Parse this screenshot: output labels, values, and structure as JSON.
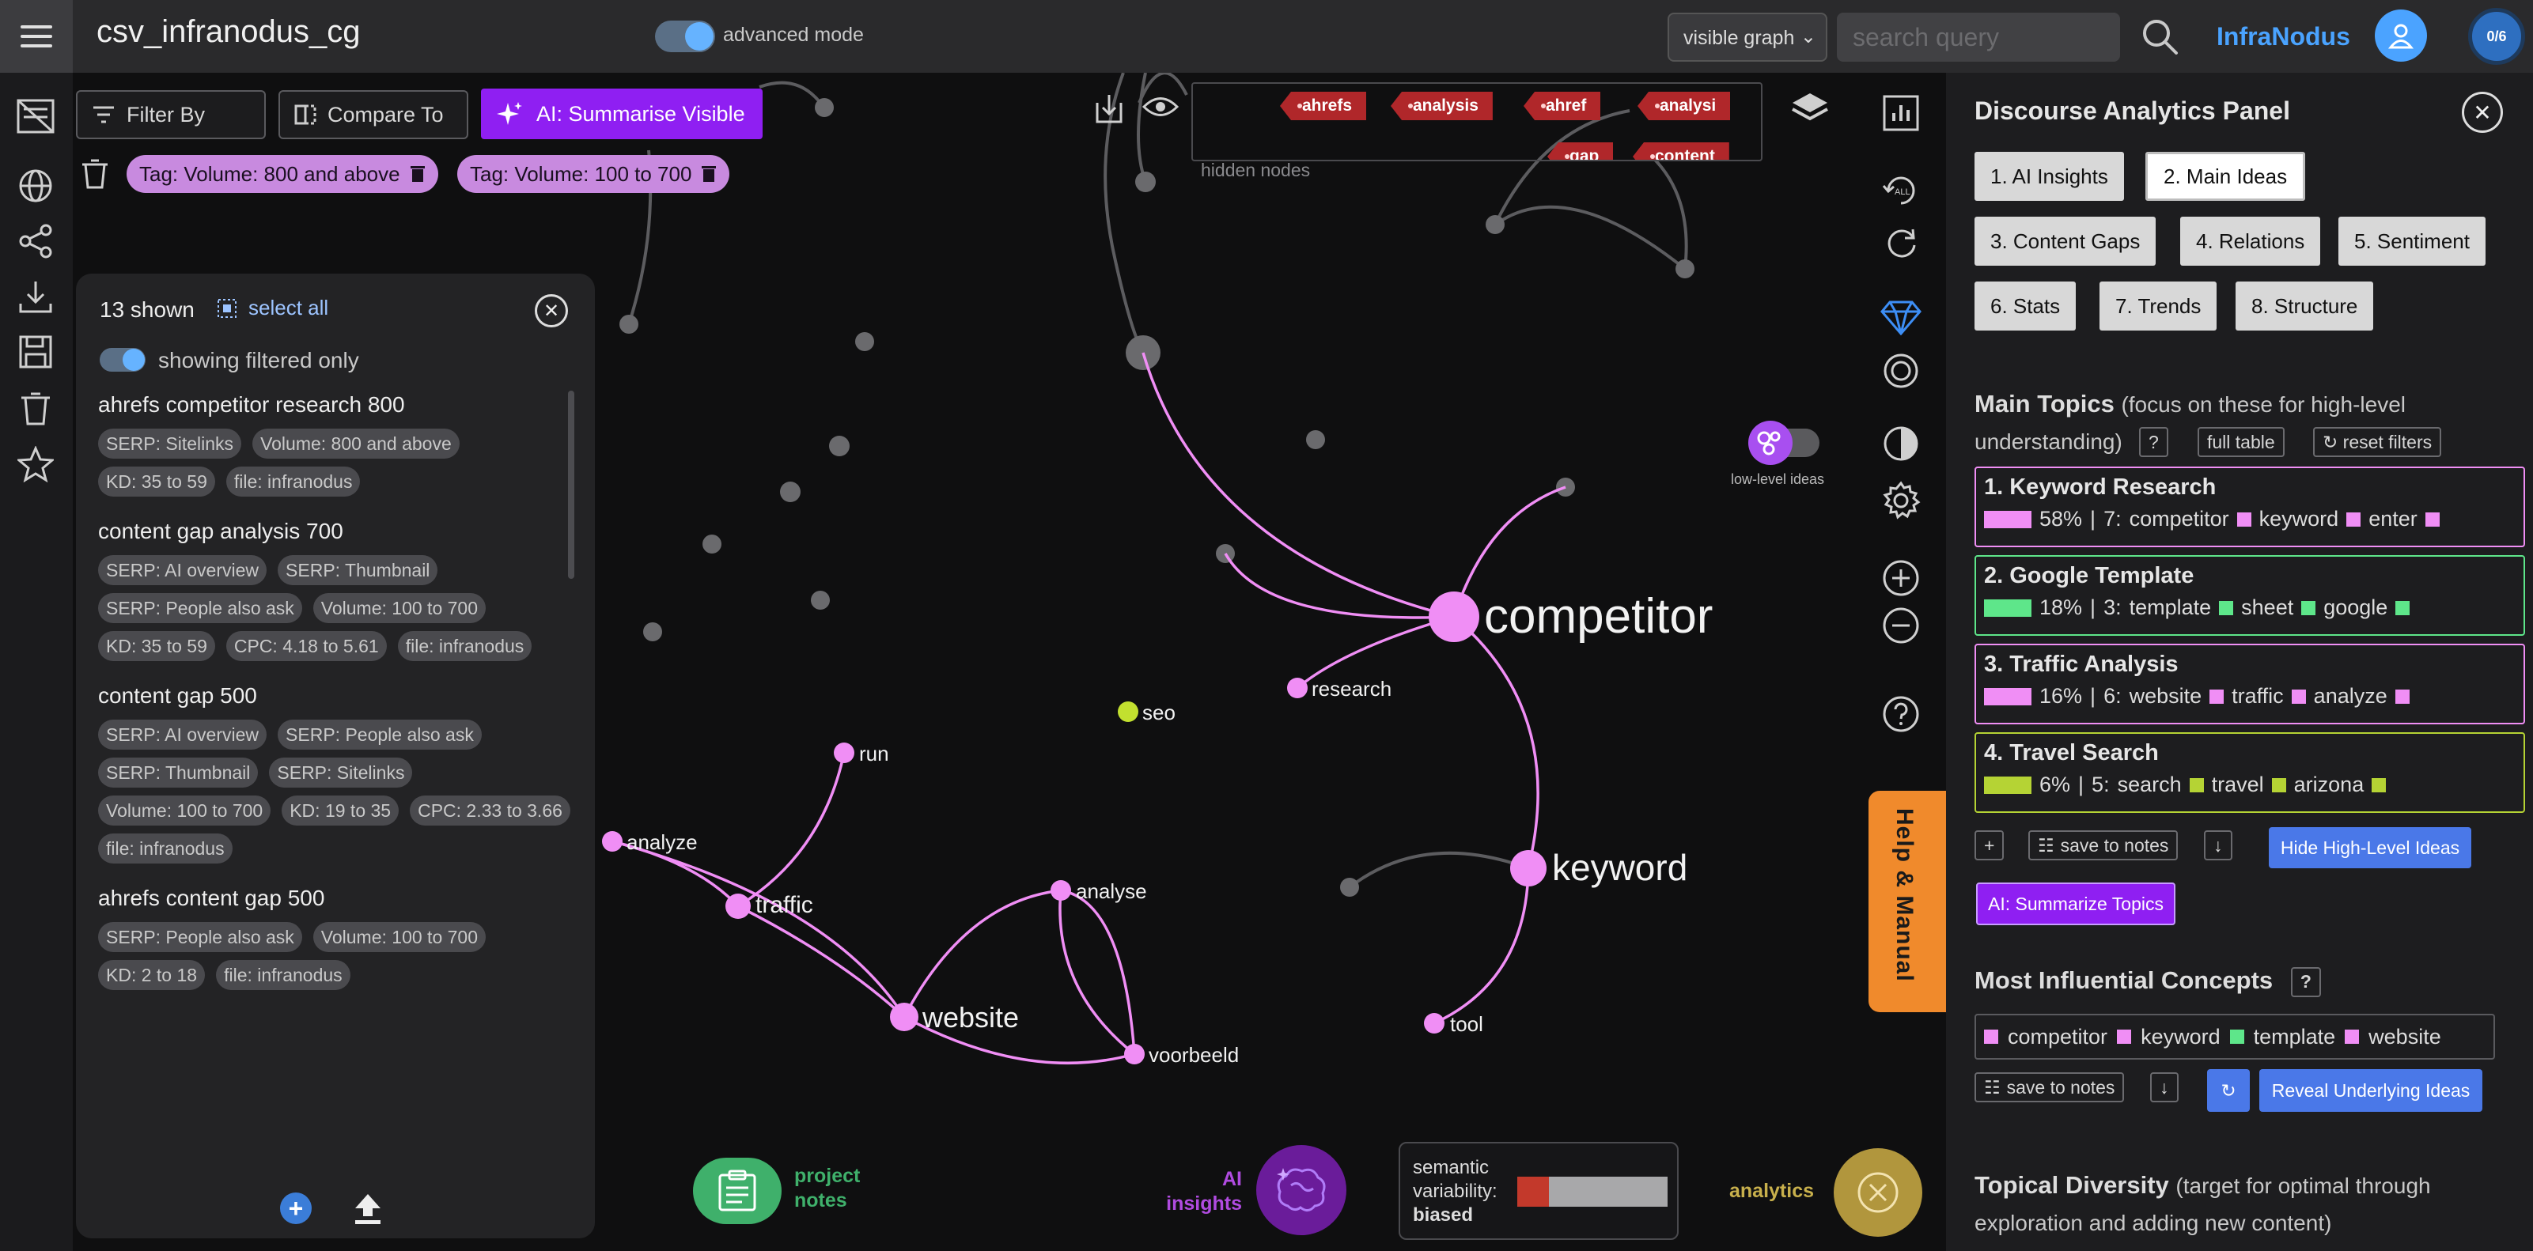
{
  "topbar": {
    "project_title": "csv_infranodus_cg",
    "advanced_mode_label": "advanced mode",
    "graph_select": "visible graph",
    "search_placeholder": "search query",
    "brand": "InfraNodus",
    "counter": "0/6"
  },
  "toolbar": {
    "filter_by": "Filter By",
    "compare_to": "Compare To",
    "ai_summarise": "AI: Summarise Visible",
    "tags": [
      "Tag: Volume: 800 and above",
      "Tag: Volume: 100 to 700"
    ]
  },
  "hidden_nodes": {
    "label": "hidden nodes",
    "tags": [
      "ahrefs",
      "analysis",
      "ahref",
      "analysi",
      "gap",
      "content"
    ]
  },
  "filter_panel": {
    "shown_count": "13 shown",
    "select_all": "select all",
    "showing_filtered": "showing filtered only",
    "results": [
      {
        "title": "ahrefs competitor research 800",
        "chips": [
          "SERP: Sitelinks",
          "Volume: 800 and above",
          "KD: 35 to 59",
          "file: infranodus"
        ]
      },
      {
        "title": "content gap analysis 700",
        "chips": [
          "SERP: AI overview",
          "SERP: Thumbnail",
          "SERP: People also ask",
          "Volume: 100 to 700",
          "KD: 35 to 59",
          "CPC: 4.18 to 5.61",
          "file: infranodus"
        ]
      },
      {
        "title": "content gap 500",
        "chips": [
          "SERP: AI overview",
          "SERP: People also ask",
          "SERP: Thumbnail",
          "SERP: Sitelinks",
          "Volume: 100 to 700",
          "KD: 19 to 35",
          "CPC: 2.33 to 3.66",
          "file: infranodus"
        ]
      },
      {
        "title": "ahrefs content gap 500",
        "chips": [
          "SERP: People also ask",
          "Volume: 100 to 700",
          "KD: 2 to 18",
          "file: infranodus"
        ]
      }
    ]
  },
  "graph": {
    "nodes": {
      "competitor": "competitor",
      "keyword": "keyword",
      "website": "website",
      "traffic": "traffic",
      "research": "research",
      "seo": "seo",
      "run": "run",
      "analyze_left": "analyze",
      "analyse": "analyse",
      "voorbeeld": "voorbeeld",
      "tool": "tool"
    },
    "low_level_ideas": "low-level ideas",
    "help_manual": "Help & Manual"
  },
  "bottom": {
    "project_notes_line1": "project",
    "project_notes_line2": "notes",
    "ai_insights_line1": "AI",
    "ai_insights_line2": "insights",
    "semantic_line1": "semantic",
    "semantic_line2": "variability:",
    "semantic_value": "biased",
    "semantic_fill_fraction": 0.21,
    "analytics": "analytics"
  },
  "analytics_panel": {
    "title": "Discourse Analytics Panel",
    "tabs": [
      "1. AI Insights",
      "2. Main Ideas",
      "3. Content Gaps",
      "4. Relations",
      "5. Sentiment",
      "6. Stats",
      "7. Trends",
      "8. Structure"
    ],
    "active_tab": "2. Main Ideas",
    "main_topics_title": "Main Topics",
    "main_topics_sub": "(focus on these for high-level understanding)",
    "help_q": "?",
    "full_table": "full table",
    "reset_filters": "↻ reset filters",
    "topics": [
      {
        "title": "1. Keyword Research",
        "pct": "58%",
        "count": "7:",
        "terms": [
          "competitor",
          "keyword",
          "enter"
        ],
        "color": "#f08ef5"
      },
      {
        "title": "2. Google Template",
        "pct": "18%",
        "count": "3:",
        "terms": [
          "template",
          "sheet",
          "google"
        ],
        "color": "#5ee68a"
      },
      {
        "title": "3. Traffic Analysis",
        "pct": "16%",
        "count": "6:",
        "terms": [
          "website",
          "traffic",
          "analyze"
        ],
        "color": "#f08ef5"
      },
      {
        "title": "4. Travel Search",
        "pct": "6%",
        "count": "5:",
        "terms": [
          "search",
          "travel",
          "arizona"
        ],
        "color": "#b5d334"
      }
    ],
    "plus": "+",
    "save_to_notes": "save to notes",
    "down": "↓",
    "hide_high_level": "Hide High-Level Ideas",
    "ai_summarize_topics": "AI: Summarize Topics",
    "influential_title": "Most Influential Concepts",
    "concepts": [
      "competitor",
      "keyword",
      "template",
      "website"
    ],
    "concept_colors": [
      "#f08ef5",
      "#f08ef5",
      "#5ee68a",
      "#f08ef5"
    ],
    "refresh": "↻",
    "reveal": "Reveal Underlying Ideas",
    "diversity_title": "Topical Diversity",
    "diversity_sub": "(target for optimal through exploration and adding new content)"
  }
}
